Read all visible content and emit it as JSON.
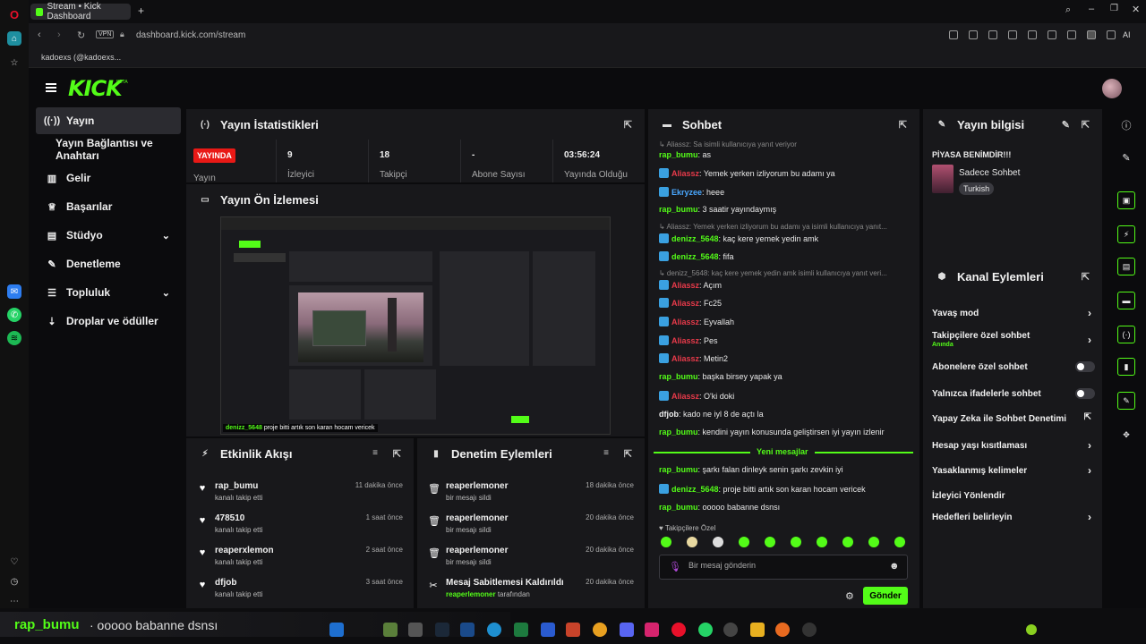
{
  "browser": {
    "tab_title": "Stream • Kick Dashboard",
    "vpn": "VPN",
    "url": "dashboard.kick.com/stream",
    "bookmark": "kadoexs (@kadoexs..."
  },
  "kick": {
    "logo": "KICK",
    "logo_beta": "BETA"
  },
  "nav": {
    "items": [
      {
        "label": "Yayın"
      },
      {
        "label": "Yayın Bağlantısı ve Anahtarı"
      },
      {
        "label": "Gelir"
      },
      {
        "label": "Başarılar"
      },
      {
        "label": "Stüdyo"
      },
      {
        "label": "Denetleme"
      },
      {
        "label": "Topluluk"
      },
      {
        "label": "Droplar ve ödüller"
      }
    ]
  },
  "stats": {
    "title": "Yayın İstatistikleri",
    "live_badge": "YAYINDA",
    "live_label": "Yayın",
    "viewers": {
      "value": "9",
      "label": "İzleyici"
    },
    "followers": {
      "value": "18",
      "label": "Takipçi"
    },
    "subs": {
      "value": "-",
      "label": "Abone Sayısı"
    },
    "uptime": {
      "value": "03:56:24",
      "label": "Yayında Olduğu"
    }
  },
  "preview": {
    "title": "Yayın Ön İzlemesi",
    "caption_user": "denizz_5648",
    "caption_text": "proje bitti artık son karan hocam vericek"
  },
  "activity": {
    "title": "Etkinlik Akışı",
    "items": [
      {
        "name": "rap_bumu",
        "sub": "kanalı takip etti",
        "time": "11 dakika önce"
      },
      {
        "name": "478510",
        "sub": "kanalı takip etti",
        "time": "1 saat önce"
      },
      {
        "name": "reaperxlemon",
        "sub": "kanalı takip etti",
        "time": "2 saat önce"
      },
      {
        "name": "dfjob",
        "sub": "kanalı takip etti",
        "time": "3 saat önce"
      }
    ]
  },
  "moderation": {
    "title": "Denetim Eylemleri",
    "items": [
      {
        "name": "reaperlemoner",
        "sub": "bir mesajı sildi",
        "time": "18 dakika önce"
      },
      {
        "name": "reaperlemoner",
        "sub": "bir mesajı sildi",
        "time": "20 dakika önce"
      },
      {
        "name": "reaperlemoner",
        "sub": "bir mesajı sildi",
        "time": "20 dakika önce"
      },
      {
        "name": "Mesaj Sabitlemesi Kaldırıldı",
        "sub_user": "reaperlemoner",
        "sub": "tarafından",
        "time": "20 dakika önce"
      }
    ]
  },
  "chat": {
    "title": "Sohbet",
    "messages": [
      {
        "type": "reply",
        "text": "↳ Aliassz: Sa isimli kullanıcıya yanıt veriyor"
      },
      {
        "user": "rap_bumu",
        "color": "#53fc18",
        "badge": false,
        "text": "as"
      },
      {
        "user": "Aliassz",
        "color": "#e83a4a",
        "badge": true,
        "text": "Yemek yerken izliyorum bu adamı ya"
      },
      {
        "user": "Ekryzee",
        "color": "#4aa8ff",
        "badge": true,
        "text": "heee"
      },
      {
        "user": "rap_bumu",
        "color": "#53fc18",
        "badge": false,
        "text": "3 saatir yayındaymış"
      },
      {
        "type": "reply",
        "text": "↳ Aliassz: Yemek yerken izliyorum bu adamı ya isimli kullanıcıya yanıt..."
      },
      {
        "user": "denizz_5648",
        "color": "#53fc18",
        "badge": true,
        "text": "kaç kere yemek yedin amk"
      },
      {
        "user": "denizz_5648",
        "color": "#53fc18",
        "badge": true,
        "text": "fifa"
      },
      {
        "type": "reply",
        "text": "↳ denizz_5648: kaç kere yemek yedin amk isimli kullanıcıya yanıt veri..."
      },
      {
        "user": "Aliassz",
        "color": "#e83a4a",
        "badge": true,
        "text": "Açım"
      },
      {
        "user": "Aliassz",
        "color": "#e83a4a",
        "badge": true,
        "text": "Fc25"
      },
      {
        "user": "Aliassz",
        "color": "#e83a4a",
        "badge": true,
        "text": "Eyvallah"
      },
      {
        "user": "Aliassz",
        "color": "#e83a4a",
        "badge": true,
        "text": "Pes"
      },
      {
        "user": "Aliassz",
        "color": "#e83a4a",
        "badge": true,
        "text": "Metin2"
      },
      {
        "user": "rap_bumu",
        "color": "#53fc18",
        "badge": false,
        "text": "başka birsey yapak ya"
      },
      {
        "user": "Aliassz",
        "color": "#e83a4a",
        "badge": true,
        "text": "O'ki doki"
      },
      {
        "user": "dfjob",
        "color": "#f0f0f0",
        "badge": false,
        "text": "kado ne iyl 8 de açtı la"
      },
      {
        "user": "rap_bumu",
        "color": "#53fc18",
        "badge": false,
        "text": "kendini yayın konusunda geliştirsen iyi yayın izlenir"
      }
    ],
    "new_messages_label": "Yeni mesajlar",
    "new_messages": [
      {
        "user": "rap_bumu",
        "color": "#53fc18",
        "badge": false,
        "text": "şarkı falan dinleyk senin şarkı zevkin iyi"
      },
      {
        "user": "denizz_5648",
        "color": "#53fc18",
        "badge": true,
        "text": "proje bitti artık son karan hocam vericek"
      },
      {
        "user": "rap_bumu",
        "color": "#53fc18",
        "badge": false,
        "text": "ooooo babanne dsnsı"
      }
    ],
    "follower_only": "♥ Takipçilere Özel",
    "input_placeholder": "Bir mesaj gönderin",
    "send_label": "Gönder"
  },
  "stream_info": {
    "title": "Yayın bilgisi",
    "stream_title": "PİYASA BENİMDİR!!!",
    "category": "Sadece Sohbet",
    "language": "Turkish"
  },
  "channel_actions": {
    "title": "Kanal Eylemleri",
    "items": [
      {
        "label": "Yavaş mod",
        "kind": "chevron"
      },
      {
        "label": "Takipçilere özel sohbet",
        "sub": "Anında",
        "kind": "chevron"
      },
      {
        "label": "Abonelere özel sohbet",
        "kind": "toggle"
      },
      {
        "label": "Yalnızca ifadelerle sohbet",
        "kind": "toggle"
      },
      {
        "label": "Yapay Zeka ile Sohbet Denetimi",
        "kind": "external"
      },
      {
        "label": "Hesap yaşı kısıtlaması",
        "kind": "chevron"
      },
      {
        "label": "Yasaklanmış kelimeler",
        "kind": "chevron"
      },
      {
        "label": "İzleyici Yönlendir",
        "kind": "none"
      },
      {
        "label": "Hedefleri belirleyin",
        "kind": "chevron"
      }
    ]
  },
  "overlay": {
    "user": "rap_bumu",
    "text": "· ooooo babanne dsnsı"
  },
  "colors": {
    "accent": "#53fc18",
    "live": "#e91916",
    "panel": "#18181b"
  }
}
